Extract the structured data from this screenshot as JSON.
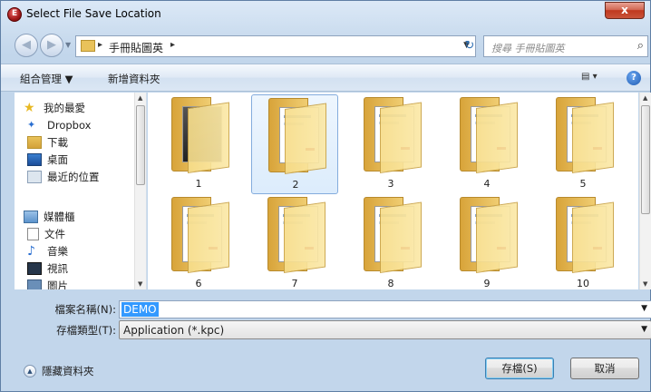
{
  "window": {
    "title": "Select File Save Location",
    "close_label": "x"
  },
  "address": {
    "path_folder": "手冊貼圖英",
    "separator": "▸",
    "search_placeholder": "搜尋 手冊貼圖英"
  },
  "toolbar": {
    "organize_label": "組合管理 ▼",
    "new_folder_label": "新增資料夾",
    "view_label": "▤ ▾",
    "help_label": "?"
  },
  "nav": {
    "favorites_label": "我的最愛",
    "favorites": [
      {
        "label": "Dropbox",
        "icon": "dropbox-icon"
      },
      {
        "label": "下載",
        "icon": "downloads-icon"
      },
      {
        "label": "桌面",
        "icon": "desktop-icon"
      },
      {
        "label": "最近的位置",
        "icon": "recent-places-icon"
      }
    ],
    "libraries_label": "媒體櫃",
    "libraries": [
      {
        "label": "文件",
        "icon": "documents-icon"
      },
      {
        "label": "音樂",
        "icon": "music-icon"
      },
      {
        "label": "視訊",
        "icon": "videos-icon"
      },
      {
        "label": "圖片",
        "icon": "pictures-icon"
      }
    ]
  },
  "files": [
    {
      "label": "1",
      "selected": false
    },
    {
      "label": "2",
      "selected": true
    },
    {
      "label": "3",
      "selected": false
    },
    {
      "label": "4",
      "selected": false
    },
    {
      "label": "5",
      "selected": false
    },
    {
      "label": "6",
      "selected": false
    },
    {
      "label": "7",
      "selected": false
    },
    {
      "label": "8",
      "selected": false
    },
    {
      "label": "9",
      "selected": false
    },
    {
      "label": "10",
      "selected": false
    }
  ],
  "form": {
    "filename_label": "檔案名稱(N):",
    "filename_value": "DEMO",
    "filetype_label": "存檔類型(T):",
    "filetype_value": "Application (*.kpc)"
  },
  "footer": {
    "hide_folders_label": "隱藏資料夾",
    "save_label": "存檔(S)",
    "cancel_label": "取消"
  }
}
